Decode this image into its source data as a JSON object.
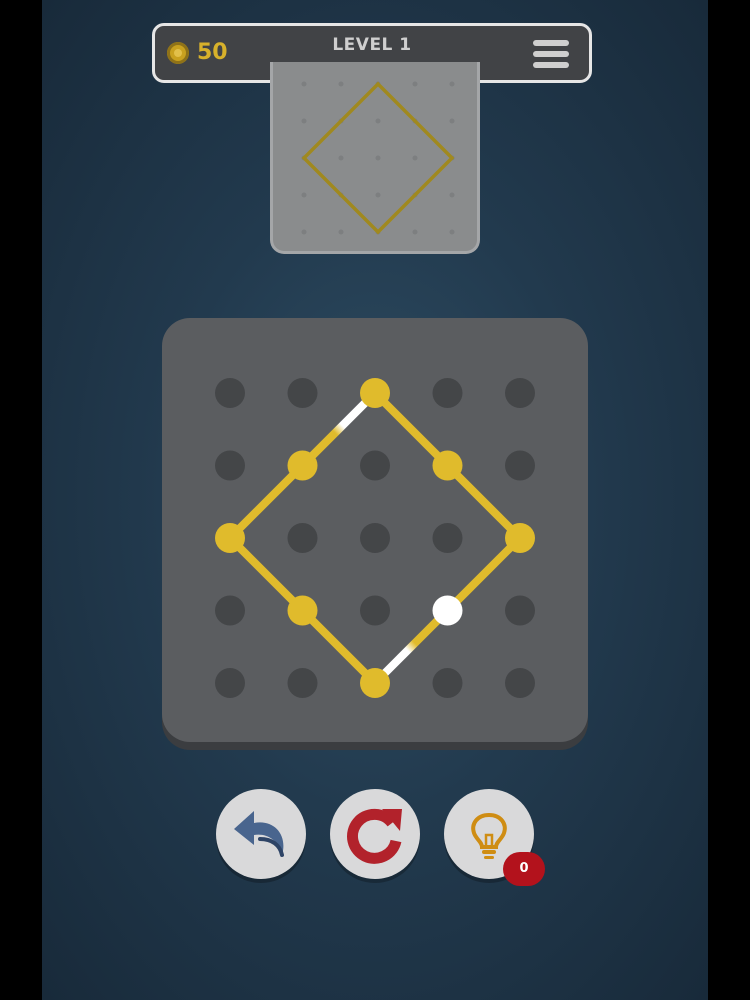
{
  "header": {
    "coins": "50",
    "level_label": "LEVEL 1"
  },
  "colors": {
    "gold": "#e0bb2c",
    "white_segment": "#ffffff",
    "board": "#5b5d60",
    "inactive_dot": "#444648",
    "preview_outline": "#a0891f",
    "restart_red": "#b2222b",
    "undo_blue": "#49658e",
    "hint_orange": "#cf8d13",
    "badge_red": "#b3121c"
  },
  "icons": {
    "coin": "coin-icon",
    "menu": "hamburger-menu-icon",
    "undo": "undo-arrow-icon",
    "restart": "restart-arrow-icon",
    "hint": "lightbulb-icon"
  },
  "grid": {
    "rows": 5,
    "cols": 5,
    "target_shape": [
      [
        0,
        2
      ],
      [
        2,
        4
      ],
      [
        4,
        2
      ],
      [
        2,
        0
      ]
    ],
    "drawn_segments": [
      {
        "from": [
          1,
          1
        ],
        "to": [
          0,
          2
        ],
        "state": "partial-white"
      },
      {
        "from": [
          0,
          2
        ],
        "to": [
          2,
          4
        ],
        "state": "complete"
      },
      {
        "from": [
          2,
          4
        ],
        "to": [
          3,
          3
        ],
        "state": "complete"
      },
      {
        "from": [
          3,
          3
        ],
        "to": [
          4,
          2
        ],
        "state": "partial-white"
      },
      {
        "from": [
          4,
          2
        ],
        "to": [
          2,
          0
        ],
        "state": "complete"
      },
      {
        "from": [
          2,
          0
        ],
        "to": [
          1,
          1
        ],
        "state": "complete"
      }
    ],
    "gold_dots": [
      [
        0,
        2
      ],
      [
        1,
        1
      ],
      [
        1,
        3
      ],
      [
        2,
        0
      ],
      [
        2,
        4
      ],
      [
        3,
        1
      ],
      [
        4,
        2
      ]
    ],
    "active_dot": [
      3,
      3
    ]
  },
  "hint": {
    "count": "0"
  }
}
